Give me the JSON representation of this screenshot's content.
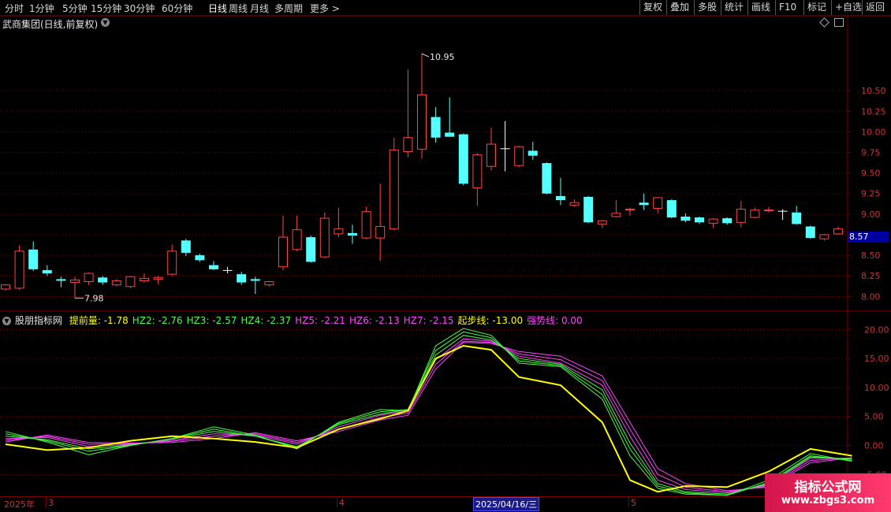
{
  "toolbar": {
    "left_items": [
      "分时",
      "1分钟",
      "5分钟",
      "15分钟",
      "30分钟",
      "60分钟",
      "日线",
      "周线",
      "月线",
      "多周期",
      "更多 >"
    ],
    "active_item": "日线",
    "right_items": [
      "复权",
      "叠加",
      "多股",
      "统计",
      "画线",
      "F10",
      "标记",
      "+自选",
      "返回"
    ]
  },
  "stock_title": "武商集团(日线,前复权)",
  "indicator_name": "股朋指标网",
  "indicator_values": [
    {
      "label": "提前量",
      "value": "-1.78",
      "color": "#ffff00"
    },
    {
      "label": "HZ2",
      "value": "-2.76",
      "color": "#44ff44"
    },
    {
      "label": "HZ3",
      "value": "-2.57",
      "color": "#44ff44"
    },
    {
      "label": "HZ4",
      "value": "-2.37",
      "color": "#44ff44"
    },
    {
      "label": "HZ5",
      "value": "-2.21",
      "color": "#ff44ff"
    },
    {
      "label": "HZ6",
      "value": "-2.13",
      "color": "#ff44ff"
    },
    {
      "label": "HZ7",
      "value": "-2.15",
      "color": "#ff44ff"
    },
    {
      "label": "起步线",
      "value": "-13.00",
      "color": "#ffff00"
    },
    {
      "label": "强势线",
      "value": "0.00",
      "color": "#ff44ff"
    }
  ],
  "last_price_tag": "8.57",
  "date_axis": {
    "labels": [
      {
        "text": "2025年",
        "pos": "start"
      },
      {
        "text": "3",
        "pos": "mar"
      },
      {
        "text": "4",
        "pos": "apr"
      },
      {
        "text": "5",
        "pos": "may"
      }
    ],
    "highlight": "2025/04/16/三"
  },
  "watermark": {
    "line1": "指标公式网",
    "line2": "www.zbgs3.com"
  },
  "colors": {
    "up": "#ff4444",
    "down": "#54ffff",
    "yellow": "#ffff00",
    "green": "#44ff44",
    "magenta": "#ff44ff",
    "grid": "#7a0000"
  },
  "chart_data": [
    {
      "type": "candlestick",
      "title": "",
      "ylim": [
        7.85,
        11.2
      ],
      "yticks": [
        8.0,
        8.25,
        8.5,
        8.75,
        9.0,
        9.25,
        9.5,
        9.75,
        10.0,
        10.25,
        10.5
      ],
      "annotations": [
        {
          "text": "10.95",
          "type": "high"
        },
        {
          "text": "7.98",
          "type": "low"
        }
      ],
      "candles": [
        {
          "o": 8.09,
          "c": 8.14,
          "h": 8.15,
          "l": 8.07
        },
        {
          "o": 8.1,
          "c": 8.55,
          "h": 8.62,
          "l": 8.08
        },
        {
          "o": 8.57,
          "c": 8.33,
          "h": 8.67,
          "l": 8.31
        },
        {
          "o": 8.32,
          "c": 8.28,
          "h": 8.38,
          "l": 8.25
        },
        {
          "o": 8.21,
          "c": 8.19,
          "h": 8.24,
          "l": 8.11
        },
        {
          "o": 8.17,
          "c": 8.2,
          "h": 8.24,
          "l": 7.98
        },
        {
          "o": 8.18,
          "c": 8.28,
          "h": 8.29,
          "l": 8.14
        },
        {
          "o": 8.23,
          "c": 8.17,
          "h": 8.25,
          "l": 8.14
        },
        {
          "o": 8.14,
          "c": 8.19,
          "h": 8.21,
          "l": 8.12
        },
        {
          "o": 8.12,
          "c": 8.24,
          "h": 8.25,
          "l": 8.1
        },
        {
          "o": 8.19,
          "c": 8.22,
          "h": 8.28,
          "l": 8.17
        },
        {
          "o": 8.21,
          "c": 8.23,
          "h": 8.25,
          "l": 8.15
        },
        {
          "o": 8.27,
          "c": 8.55,
          "h": 8.63,
          "l": 8.25
        },
        {
          "o": 8.68,
          "c": 8.53,
          "h": 8.7,
          "l": 8.49
        },
        {
          "o": 8.5,
          "c": 8.44,
          "h": 8.52,
          "l": 8.42
        },
        {
          "o": 8.38,
          "c": 8.33,
          "h": 8.43,
          "l": 8.32
        },
        {
          "o": 8.32,
          "c": 8.32,
          "h": 8.36,
          "l": 8.28
        },
        {
          "o": 8.27,
          "c": 8.17,
          "h": 8.3,
          "l": 8.14
        },
        {
          "o": 8.21,
          "c": 8.19,
          "h": 8.24,
          "l": 8.03
        },
        {
          "o": 8.14,
          "c": 8.18,
          "h": 8.19,
          "l": 8.12
        },
        {
          "o": 8.36,
          "c": 8.72,
          "h": 8.98,
          "l": 8.32
        },
        {
          "o": 8.57,
          "c": 8.81,
          "h": 8.98,
          "l": 8.55
        },
        {
          "o": 8.72,
          "c": 8.42,
          "h": 8.74,
          "l": 8.41
        },
        {
          "o": 8.48,
          "c": 8.95,
          "h": 9.02,
          "l": 8.47
        },
        {
          "o": 8.76,
          "c": 8.82,
          "h": 9.08,
          "l": 8.72
        },
        {
          "o": 8.77,
          "c": 8.74,
          "h": 8.87,
          "l": 8.64
        },
        {
          "o": 8.71,
          "c": 9.03,
          "h": 9.09,
          "l": 8.7
        },
        {
          "o": 8.71,
          "c": 8.85,
          "h": 9.37,
          "l": 8.43
        },
        {
          "o": 8.82,
          "c": 9.78,
          "h": 9.93,
          "l": 8.8
        },
        {
          "o": 9.76,
          "c": 9.93,
          "h": 10.76,
          "l": 9.69
        },
        {
          "o": 9.79,
          "c": 10.45,
          "h": 10.95,
          "l": 9.67
        },
        {
          "o": 10.18,
          "c": 9.93,
          "h": 10.3,
          "l": 9.87
        },
        {
          "o": 9.99,
          "c": 9.94,
          "h": 10.42,
          "l": 9.94
        },
        {
          "o": 9.97,
          "c": 9.37,
          "h": 9.98,
          "l": 9.35
        },
        {
          "o": 9.32,
          "c": 9.72,
          "h": 9.74,
          "l": 9.1
        },
        {
          "o": 9.58,
          "c": 9.85,
          "h": 10.05,
          "l": 9.53
        },
        {
          "o": 9.8,
          "c": 9.8,
          "h": 10.13,
          "l": 9.52
        },
        {
          "o": 9.59,
          "c": 9.82,
          "h": 9.83,
          "l": 9.57
        },
        {
          "o": 9.77,
          "c": 9.71,
          "h": 9.88,
          "l": 9.66
        },
        {
          "o": 9.62,
          "c": 9.25,
          "h": 9.63,
          "l": 9.24
        },
        {
          "o": 9.22,
          "c": 9.17,
          "h": 9.44,
          "l": 9.11
        },
        {
          "o": 9.11,
          "c": 9.14,
          "h": 9.18,
          "l": 9.09
        },
        {
          "o": 9.21,
          "c": 8.9,
          "h": 9.22,
          "l": 8.89
        },
        {
          "o": 8.88,
          "c": 8.92,
          "h": 8.93,
          "l": 8.83
        },
        {
          "o": 8.97,
          "c": 9.01,
          "h": 9.17,
          "l": 8.96
        },
        {
          "o": 9.05,
          "c": 9.06,
          "h": 9.08,
          "l": 8.98
        },
        {
          "o": 9.14,
          "c": 9.11,
          "h": 9.25,
          "l": 9.05
        },
        {
          "o": 9.07,
          "c": 9.2,
          "h": 9.21,
          "l": 9.01
        },
        {
          "o": 9.17,
          "c": 8.96,
          "h": 9.18,
          "l": 8.95
        },
        {
          "o": 8.97,
          "c": 8.92,
          "h": 9.01,
          "l": 8.9
        },
        {
          "o": 8.96,
          "c": 8.9,
          "h": 8.97,
          "l": 8.88
        },
        {
          "o": 8.89,
          "c": 8.94,
          "h": 8.95,
          "l": 8.83
        },
        {
          "o": 8.95,
          "c": 8.89,
          "h": 8.96,
          "l": 8.87
        },
        {
          "o": 8.9,
          "c": 9.06,
          "h": 9.16,
          "l": 8.84
        },
        {
          "o": 8.96,
          "c": 9.05,
          "h": 9.08,
          "l": 8.95
        },
        {
          "o": 9.04,
          "c": 9.05,
          "h": 9.09,
          "l": 9.02
        },
        {
          "o": 9.04,
          "c": 9.04,
          "h": 9.06,
          "l": 8.93
        },
        {
          "o": 9.02,
          "c": 8.88,
          "h": 9.1,
          "l": 8.87
        },
        {
          "o": 8.85,
          "c": 8.71,
          "h": 8.86,
          "l": 8.7
        },
        {
          "o": 8.7,
          "c": 8.75,
          "h": 8.76,
          "l": 8.68
        },
        {
          "o": 8.76,
          "c": 8.82,
          "h": 8.85,
          "l": 8.75
        }
      ]
    },
    {
      "type": "line",
      "title": "",
      "ylim": [
        -8.5,
        22.5
      ],
      "yticks": [
        -5.0,
        0.0,
        5.0,
        10.0,
        15.0,
        20.0
      ],
      "x": [
        0,
        3,
        6,
        9,
        12,
        15,
        18,
        21,
        24,
        27,
        29,
        31,
        33,
        35,
        37,
        40,
        43,
        45,
        47,
        49,
        52,
        55,
        58,
        61
      ],
      "series": [
        {
          "name": "提前量",
          "color": "#ffff00",
          "values": [
            0.2,
            -0.8,
            -0.4,
            0.8,
            1.6,
            1.2,
            0.6,
            -0.4,
            2.8,
            4.6,
            6.0,
            15.0,
            17.2,
            16.5,
            11.8,
            10.4,
            4.0,
            -6.0,
            -8.0,
            -7.0,
            -7.2,
            -4.5,
            -0.6,
            -1.78
          ]
        },
        {
          "name": "HZ2",
          "color": "#44ff44",
          "values": [
            2.4,
            0.6,
            -1.6,
            0.0,
            1.2,
            3.2,
            1.8,
            -0.6,
            4.0,
            6.2,
            6.0,
            17.2,
            20.2,
            19.0,
            14.2,
            13.6,
            8.0,
            -1.8,
            -7.4,
            -8.4,
            -8.6,
            -6.0,
            -1.4,
            -2.76
          ]
        },
        {
          "name": "HZ3",
          "color": "#44ff44",
          "values": [
            2.0,
            0.8,
            -1.0,
            0.0,
            1.2,
            2.8,
            1.6,
            -0.4,
            3.8,
            5.8,
            6.2,
            16.4,
            19.6,
            18.6,
            14.6,
            13.8,
            8.8,
            -0.6,
            -7.0,
            -8.2,
            -8.6,
            -6.4,
            -1.8,
            -2.57
          ]
        },
        {
          "name": "HZ4",
          "color": "#44ff44",
          "values": [
            1.6,
            1.0,
            -0.6,
            0.1,
            1.1,
            2.4,
            1.6,
            -0.2,
            3.6,
            5.4,
            6.2,
            15.6,
            19.0,
            18.2,
            15.0,
            14.0,
            9.6,
            0.4,
            -6.6,
            -8.0,
            -8.4,
            -6.6,
            -2.0,
            -2.37
          ]
        },
        {
          "name": "HZ5",
          "color": "#ff44ff",
          "values": [
            1.2,
            1.4,
            -0.2,
            0.2,
            0.9,
            2.0,
            1.8,
            0.2,
            3.2,
            5.2,
            6.0,
            14.8,
            18.4,
            18.0,
            15.4,
            14.2,
            10.4,
            1.6,
            -6.0,
            -7.6,
            -8.2,
            -6.8,
            -2.2,
            -2.21
          ]
        },
        {
          "name": "HZ6",
          "color": "#ff44ff",
          "values": [
            0.9,
            1.6,
            0.2,
            0.3,
            0.7,
            1.6,
            2.0,
            0.5,
            2.8,
            4.8,
            5.6,
            14.0,
            18.0,
            17.8,
            15.8,
            14.8,
            11.2,
            2.8,
            -5.0,
            -7.2,
            -8.0,
            -7.0,
            -2.6,
            -2.13
          ]
        },
        {
          "name": "HZ7",
          "color": "#ff44ff",
          "values": [
            0.6,
            1.8,
            0.5,
            0.4,
            0.5,
            1.2,
            2.2,
            0.8,
            2.4,
            4.4,
            5.2,
            13.2,
            17.8,
            17.6,
            16.2,
            15.4,
            12.0,
            4.0,
            -4.0,
            -6.6,
            -7.8,
            -7.2,
            -3.0,
            -2.15
          ]
        }
      ]
    }
  ]
}
